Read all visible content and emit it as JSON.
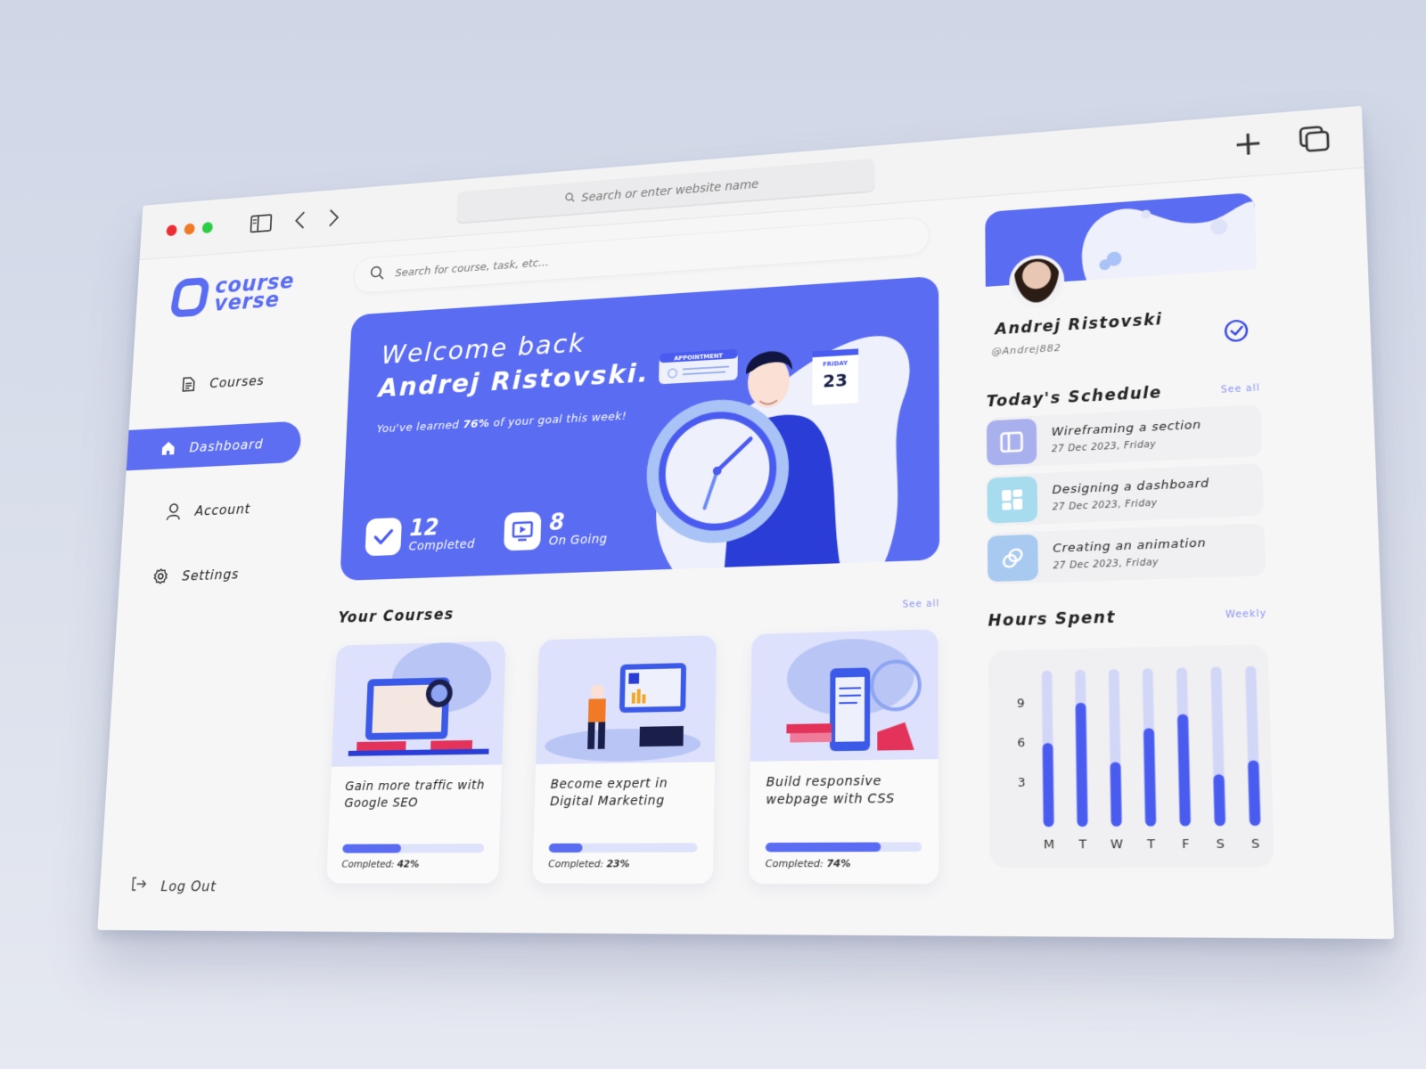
{
  "browser": {
    "address_placeholder": "Search or enter website name",
    "icons": [
      "sidebar-toggle-icon",
      "back-arrow-icon",
      "forward-arrow-icon",
      "new-tab-plus-icon",
      "tabs-overview-icon"
    ]
  },
  "brand": {
    "line1": "course",
    "line2": "verse",
    "color": "#5a6cf2"
  },
  "sidebar": {
    "items": [
      {
        "label": "Courses",
        "icon": "document-icon",
        "active": false
      },
      {
        "label": "Dashboard",
        "icon": "home-icon",
        "active": true
      },
      {
        "label": "Account",
        "icon": "user-icon",
        "active": false
      },
      {
        "label": "Settings",
        "icon": "gear-icon",
        "active": false
      }
    ],
    "logout_label": "Log Out"
  },
  "search": {
    "placeholder": "Search for course, task, etc..."
  },
  "hero": {
    "greeting": "Welcome back",
    "name": "Andrej Ristovski.",
    "subtitle_prefix": "You've learned ",
    "subtitle_value": "76%",
    "subtitle_suffix": " of your goal this week!",
    "stats": [
      {
        "value": "12",
        "label": "Completed",
        "icon": "checkmark-icon"
      },
      {
        "value": "8",
        "label": "On Going",
        "icon": "play-screen-icon"
      }
    ],
    "illustration": {
      "appointment_label": "APPOINTMENT",
      "calendar_day": "FRIDAY",
      "calendar_date": "23"
    }
  },
  "courses": {
    "title": "Your Courses",
    "see_all": "See all",
    "items": [
      {
        "title": "Gain more traffic with Google SEO",
        "completed_label": "Completed:",
        "progress": 42,
        "progress_text": "42%"
      },
      {
        "title": "Become expert in Digital Marketing",
        "completed_label": "Completed:",
        "progress": 23,
        "progress_text": "23%"
      },
      {
        "title": "Build responsive webpage with CSS",
        "completed_label": "Completed:",
        "progress": 74,
        "progress_text": "74%"
      }
    ]
  },
  "profile": {
    "name": "Andrej Ristovski",
    "handle": "@Andrej882",
    "verified": true
  },
  "schedule": {
    "title": "Today's Schedule",
    "see_all": "See all",
    "items": [
      {
        "title": "Wireframing a section",
        "date": "27 Dec 2023, Friday",
        "icon": "layout-icon",
        "color": "#a9b0ee"
      },
      {
        "title": "Designing a dashboard",
        "date": "27 Dec 2023, Friday",
        "icon": "dashboard-grid-icon",
        "color": "#a7dbee"
      },
      {
        "title": "Creating an animation",
        "date": "27 Dec 2023, Friday",
        "icon": "animation-rings-icon",
        "color": "#a8c9f0"
      }
    ]
  },
  "hours": {
    "title": "Hours Spent",
    "period": "Weekly"
  },
  "chart_data": {
    "type": "bar",
    "title": "Hours Spent",
    "categories": [
      "M",
      "T",
      "W",
      "T",
      "F",
      "S",
      "S"
    ],
    "values": [
      5.5,
      8.5,
      4,
      6.5,
      7.5,
      3,
      4
    ],
    "max_track": 11,
    "yticks": [
      3,
      6,
      9
    ],
    "ylim": [
      0,
      11
    ],
    "xlabel": "",
    "ylabel": "",
    "colors": {
      "fill": "#4a5cf0",
      "track": "#d3d7f7"
    }
  }
}
